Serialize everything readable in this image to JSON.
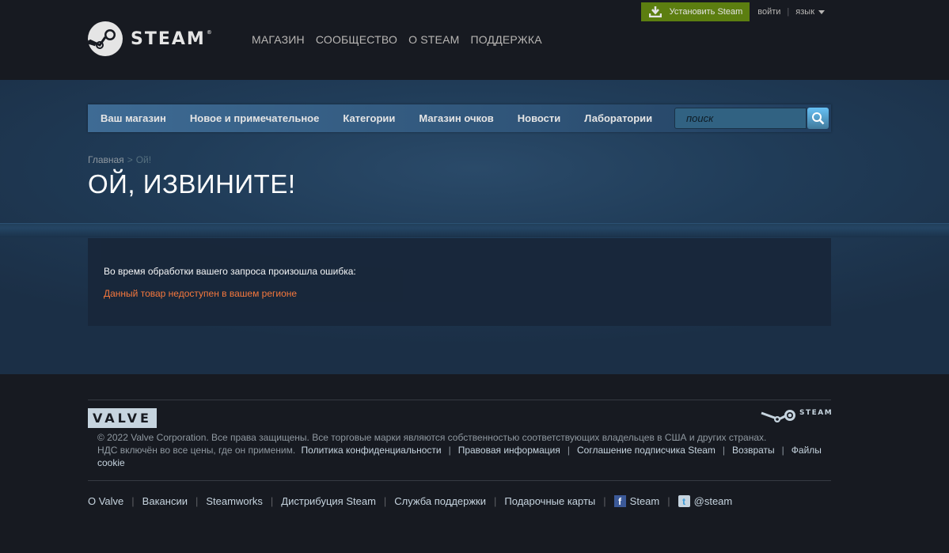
{
  "header": {
    "logo_text": "STEAM",
    "logo_tm": "®",
    "nav": [
      "МАГАЗИН",
      "СООБЩЕСТВО",
      "О STEAM",
      "ПОДДЕРЖКА"
    ],
    "install_label": "Установить Steam",
    "login_label": "войти",
    "separator": "|",
    "language_label": "язык"
  },
  "store_nav": {
    "tabs": [
      "Ваш магазин",
      "Новое и примечательное",
      "Категории",
      "Магазин очков",
      "Новости",
      "Лаборатории"
    ],
    "search_placeholder": "поиск"
  },
  "breadcrumb": {
    "home": "Главная",
    "separator": ">",
    "current": "Ой!"
  },
  "page_title": "ОЙ, ИЗВИНИТЕ!",
  "error": {
    "message": "Во время обработки вашего запроса произошла ошибка:",
    "reason": "Данный товар недоступен в вашем регионе"
  },
  "footer": {
    "valve_logo": "VALVE",
    "steam_logo": "STEAM",
    "copyright": "© 2022 Valve Corporation. Все права защищены. Все торговые марки являются собственностью соответствующих владельцев в США и других странах.",
    "vat": "НДС включён во все цены, где он применим.",
    "legal_links": [
      "Политика конфиденциальности",
      "Правовая информация",
      "Соглашение подписчика Steam",
      "Возвраты",
      "Файлы cookie"
    ],
    "links": [
      "О Valve",
      "Вакансии",
      "Steamworks",
      "Дистрибуция Steam",
      "Служба поддержки",
      "Подарочные карты"
    ],
    "facebook_label": "Steam",
    "twitter_label": "@steam",
    "separator": "|"
  },
  "colors": {
    "install_green": "#5c7e10",
    "error_orange": "#ff7b3d",
    "background": "#171a21"
  }
}
